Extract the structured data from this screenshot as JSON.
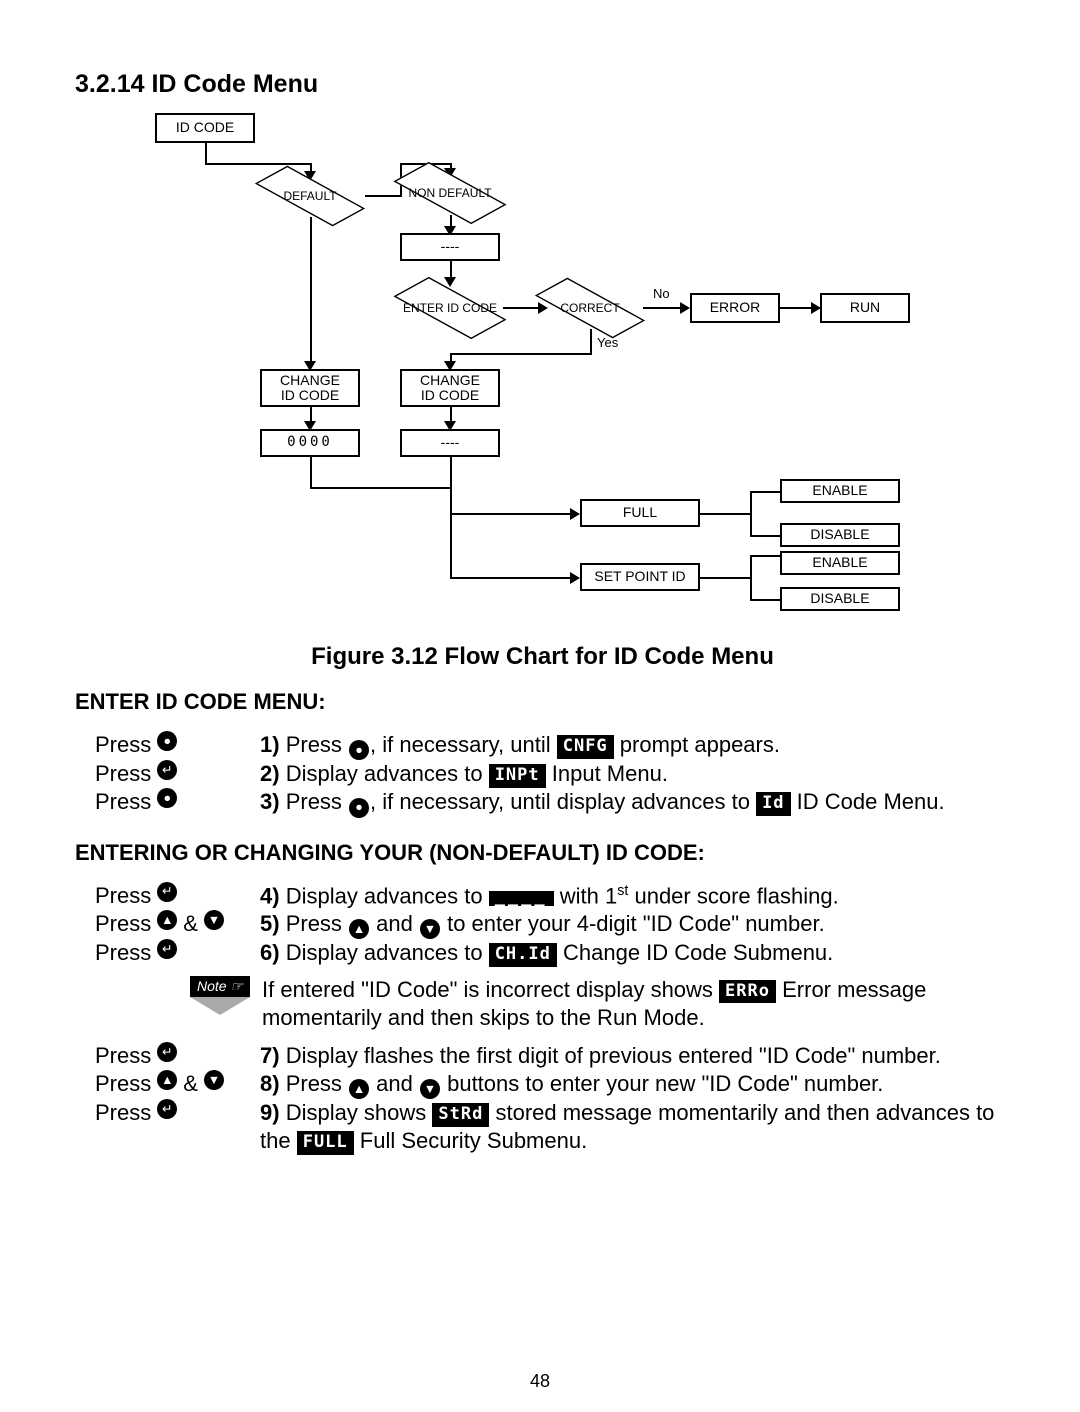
{
  "header": {
    "section_number": "3.2.14",
    "section_title": "ID Code Menu",
    "figure_label": "Figure 3.12",
    "figure_caption": "Flow Chart for ID Code Menu"
  },
  "chart_data": {
    "type": "flowchart",
    "nodes": [
      {
        "id": "idcode",
        "label": "ID CODE",
        "shape": "rect"
      },
      {
        "id": "default",
        "label": "DEFAULT",
        "shape": "diamond"
      },
      {
        "id": "nondefault",
        "label": "NON\nDEFAULT",
        "shape": "diamond"
      },
      {
        "id": "dashes1",
        "label": "----",
        "shape": "rect"
      },
      {
        "id": "enter",
        "label": "ENTER\nID CODE",
        "shape": "diamond"
      },
      {
        "id": "correct",
        "label": "CORRECT",
        "shape": "diamond"
      },
      {
        "id": "error",
        "label": "ERROR",
        "shape": "rect"
      },
      {
        "id": "run",
        "label": "RUN",
        "shape": "rect"
      },
      {
        "id": "change1",
        "label": "CHANGE\nID CODE",
        "shape": "rect"
      },
      {
        "id": "change2",
        "label": "CHANGE\nID CODE",
        "shape": "rect"
      },
      {
        "id": "zeros",
        "label": "0000",
        "shape": "rect"
      },
      {
        "id": "dashes2",
        "label": "----",
        "shape": "rect"
      },
      {
        "id": "full",
        "label": "FULL",
        "shape": "rect"
      },
      {
        "id": "full_en",
        "label": "ENABLE",
        "shape": "rect"
      },
      {
        "id": "full_dis",
        "label": "DISABLE",
        "shape": "rect"
      },
      {
        "id": "spid",
        "label": "SET POINT ID",
        "shape": "rect"
      },
      {
        "id": "sp_en",
        "label": "ENABLE",
        "shape": "rect"
      },
      {
        "id": "sp_dis",
        "label": "DISABLE",
        "shape": "rect"
      }
    ],
    "edges": [
      {
        "from": "idcode",
        "to": "default"
      },
      {
        "from": "default",
        "to": "nondefault"
      },
      {
        "from": "nondefault",
        "to": "dashes1"
      },
      {
        "from": "dashes1",
        "to": "enter"
      },
      {
        "from": "enter",
        "to": "correct"
      },
      {
        "from": "correct",
        "to": "error",
        "label": "No"
      },
      {
        "from": "error",
        "to": "run"
      },
      {
        "from": "correct",
        "to": "change2",
        "label": "Yes"
      },
      {
        "from": "default",
        "to": "change1"
      },
      {
        "from": "change1",
        "to": "zeros"
      },
      {
        "from": "change2",
        "to": "dashes2"
      },
      {
        "from": "zeros",
        "to": "full"
      },
      {
        "from": "dashes2",
        "to": "full"
      },
      {
        "from": "full",
        "to": "full_en"
      },
      {
        "from": "full",
        "to": "full_dis"
      },
      {
        "from": "dashes2",
        "to": "spid"
      },
      {
        "from": "spid",
        "to": "sp_en"
      },
      {
        "from": "spid",
        "to": "sp_dis"
      }
    ],
    "edge_labels": {
      "no": "No",
      "yes": "Yes"
    }
  },
  "subheadings": {
    "enter_menu": "ENTER ID CODE MENU:",
    "change_code": "ENTERING OR CHANGING YOUR (NON-DEFAULT) ID CODE:"
  },
  "icons": {
    "menu": "●",
    "enter": "↵",
    "up": "▲",
    "down": "▼"
  },
  "chips": {
    "cnfg": "CNFG",
    "inpt": "INPt",
    "id": "Id",
    "dashes": "____",
    "chid": "CH.Id",
    "erro": "ERRo",
    "strd": "StRd",
    "full": "FULL"
  },
  "labels": {
    "press": "Press",
    "and": "&",
    "note": "Note ☞"
  },
  "steps": {
    "s1_a": "Press ",
    "s1_b": ", if necessary, until ",
    "s1_c": " prompt appears.",
    "s2_a": "Display advances to ",
    "s2_b": " Input Menu.",
    "s3_a": "Press ",
    "s3_b": ", if necessary, until display advances to ",
    "s3_c": " ID Code Menu.",
    "s4_a": "Display advances to ",
    "s4_b": " with 1",
    "s4_c": " under score flashing.",
    "s5_a": "Press ",
    "s5_b": " and ",
    "s5_c": " to enter your 4-digit \"ID Code\" number.",
    "s6_a": "Display advances to ",
    "s6_b": " Change ID Code Submenu.",
    "note_a": "If  entered \"ID Code\" is incorrect display shows ",
    "note_b": "  Error message momentarily and then skips to the Run Mode.",
    "s7_a": "Display flashes the first digit of previous entered \"ID Code\" number.",
    "s8_a": "Press ",
    "s8_b": " and ",
    "s8_c": " buttons to enter your new \"ID Code\" number.",
    "s9_a": "Display shows ",
    "s9_b": " stored message momentarily and then advances to the ",
    "s9_c": " Full Security Submenu.",
    "st_sup": "st"
  },
  "nums": {
    "n1": "1)",
    "n2": "2)",
    "n3": "3)",
    "n4": "4)",
    "n5": "5)",
    "n6": "6)",
    "n7": "7)",
    "n8": "8)",
    "n9": "9)"
  },
  "page_number": "48"
}
